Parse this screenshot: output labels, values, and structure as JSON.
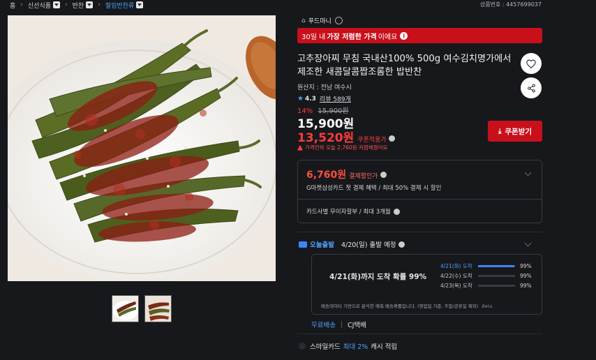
{
  "breadcrumb": {
    "home": "홈",
    "level1": "신선식품",
    "level2": "반찬",
    "level3": "절임반찬류"
  },
  "product_no": "상품번호 : 4457699037",
  "seller": "푸드마니",
  "promo": {
    "prefix": "30일 내",
    "highlight": "가장 저렴한 가격",
    "suffix": "이에요"
  },
  "title": "고추장아찌 무침 국내산100% 500g 여수김치명가에서 제조한 새콤달콤짭조롬한 밥반찬",
  "origin": "원산지 : 전남 여수시",
  "rating": {
    "score": "4.3",
    "reviews": "리뷰 589개"
  },
  "pricing": {
    "discount_pct": "14%",
    "original": "15,900원",
    "price": "15,900원",
    "coupon_price": "13,520원",
    "coupon_label": "쿠폰적용가",
    "cheap_note": "가격인하 오늘 2,760원 저렴해졌어요",
    "coupon_button": "쿠폰받기"
  },
  "card_offer": {
    "price": "6,760원",
    "label": "결제할인가",
    "desc": "G마켓삼성카드 첫 결제 혜택 / 최대 50% 결제 시 할인",
    "installment": "카드사별 무이자할부 / 최대 3개월"
  },
  "shipping": {
    "today": "오늘출발",
    "depart": "4/20(일) 출발 예정",
    "probability": "4/21(화)까지 도착 확률 99%",
    "rows": [
      {
        "date": "4/21(화) 도착",
        "pct": "99%",
        "fill": 0.99
      },
      {
        "date": "4/22(수) 도착",
        "pct": "99%",
        "fill": 0
      },
      {
        "date": "4/23(목) 도착",
        "pct": "99%",
        "fill": 0
      }
    ],
    "note": "배송데이터 기반으로 분석한 예측 배송확률입니다. (영업일 기준, 주말/공휴일 제외)",
    "beta": "Beta",
    "free": "무료배송",
    "courier": "CJ택배"
  },
  "smile": {
    "prefix": "스마일카드",
    "highlight": "최대 2%",
    "suffix": "캐시 적립"
  },
  "icons": {
    "heart": "heart-icon",
    "share": "share-icon",
    "download": "download-icon",
    "star": "star-icon",
    "truck": "truck-icon"
  },
  "colors": {
    "accent_red": "#c8101a",
    "price_red": "#ff3b3b",
    "link_blue": "#4ea1ff",
    "background": "#17181c"
  }
}
